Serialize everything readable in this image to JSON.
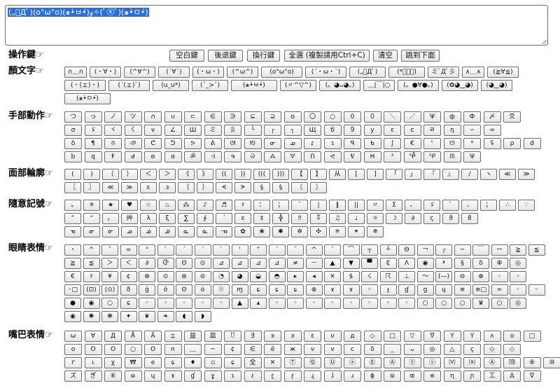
{
  "editor": {
    "text": "(„ﾟДﾟ)(o°ω°o)(๑•̀ㅂ•́)و✧(ﾟ㉨ﾟ)(๑•̀ㅁ•́)"
  },
  "sections": {
    "operations": "操作鍵☞",
    "faces": "顏文字☞",
    "hands": "手部動作☞",
    "outline": "面部輪廓☞",
    "misc": "隨意記號☞",
    "eyes": "眼睛表情☞",
    "mouth": "嘴巴表情☞"
  },
  "controls": [
    "空白鍵",
    "後退鍵",
    "換行鍵",
    "全選 (複製請用Ctrl+C)",
    "清空",
    "跳到下面"
  ],
  "faces": [
    "∩＿∩",
    "(・∀・)",
    "(^∀^)",
    "(´∀`)",
    "(・ω・)",
    "(^ω^)",
    "(o°ω°o)",
    "(´・ω・`)",
    "(„ﾟДﾟ)",
    "(*ﾟーﾟ)",
    "ミﾟДﾟ彡",
    "∧＿∧",
    "(≧∀≦)",
    "(・(ェ)・)",
    "(´(ェ)`)",
    "(u_u*)",
    "(´_>`)",
    "(๑•̀ㅂ•́)",
    "(〃^▽^)",
    "(。◕ᴗ◕。)",
    "＿|￣|○",
    "(。●∀●。)",
    "(✿◕‿◕)",
    "(◕‿◕)",
    "(๑•̀ㅁ•́)"
  ],
  "hands": {
    "row1": [
      "つ",
      "っ",
      "ノ",
      "ツ",
      "∩",
      "∪",
      "⊂",
      "∈",
      "∋",
      "⊆",
      "⊇",
      "ｏ",
      "〇",
      "○",
      "0",
      "０",
      "＼",
      "／",
      "Ψ",
      "ф",
      "Ф",
      "〆",
      "爻"
    ],
    "row2": [
      "σ",
      "ゞ",
      "ヾ",
      "ㄑ",
      "ν",
      "∠",
      "Ш",
      "ミ",
      "彡",
      "└",
      "┌",
      "┐",
      "Щ",
      "б",
      "９",
      "ｙ",
      "ε",
      "ｃ",
      "ㄹ",
      "η",
      "∽",
      "∞"
    ],
    "row3": [
      "δ",
      "¶",
      "ঙ",
      "ঞ",
      "ᕦ",
      "ᕤ",
      "ᕗ",
      "ᕕ",
      "ᘛ",
      "ᘚ",
      "ᓂ",
      "ᓄ",
      "ɾ",
      "ɿ",
      "ᑫ",
      "ᑲ",
      "∫",
      "€",
      "ᵗ",
      "ᘎ",
      "ᓑ",
      "ʢ",
      "ρ",
      "d"
    ],
    "row4": [
      "b",
      "q",
      "Ꞙ",
      "ᑯ",
      "ʚ",
      "ɞ",
      "ॐ",
      "ଏ",
      "ຈ",
      "ᘐ",
      "ᗋ",
      "ᗊ",
      "ᑎ",
      "ᕙ",
      "ᕓ",
      "ᕼ",
      "ᕽ",
      "ᕾ",
      "ᕿ",
      "ᙏ",
      "Ψ"
    ]
  },
  "outline": {
    "row1": [
      "(",
      ")",
      "（",
      "）",
      "＜",
      "＞",
      "《",
      "》",
      "((",
      "))",
      "(((",
      ")))",
      "【",
      "】",
      "从",
      "[",
      "]",
      "「",
      "」",
      "『",
      "』",
      "/",
      "ヽ",
      "≪",
      "≫"
    ],
    "row2": [
      "〖",
      "〗",
      "≪",
      "≫",
      "ɛ",
      "з",
      "〔",
      "〕",
      "ᗕ",
      "ᗒ",
      "§",
      "§",
      "〘",
      "〙"
    ]
  },
  "misc": {
    "row1": [
      "｡",
      "＊",
      "★",
      "♥",
      "☆",
      "♨",
      "⁂",
      "♪",
      "♬",
      "♯",
      "：",
      "；",
      "¨",
      "|",
      "‖",
      "||",
      "〃",
      "Σ",
      "、",
      "ゞ",
      "ﾟ",
      "．",
      "；",
      "∴",
      "∵"
    ],
    "row2": [
      "”",
      "“",
      "〟",
      "艸",
      "λ",
      "ξ",
      "∑",
      "∮",
      "´",
      "ɛ",
      "‡",
      "╬",
      "‼",
      "⁑",
      "♫",
      "♩",
      "☼",
      "☽",
      "∂",
      "ς",
      "ϑ",
      "ϐ"
    ],
    "row3": [
      "ᓀ",
      "ᓂ",
      "ᓃ",
      "ᓄ",
      "ᓅ",
      "ᓆ",
      "ᓇ",
      "ᓈ",
      "ᓉ",
      "✿",
      "❀",
      "✱",
      "✲",
      "✣",
      "✳",
      "✴",
      "✵"
    ]
  },
  "eyes": {
    "row1": [
      "・",
      "^",
      "ˇ",
      "=",
      "°",
      "ˋ",
      "ˊ",
      "ˊ",
      "ˋ",
      "'",
      "”",
      "´",
      "˜",
      "^",
      "ˉ",
      "⌒",
      "┬",
      "┴",
      "Θ",
      "￢",
      "┌",
      "─",
      "￣",
      "ー",
      "≧",
      "≦"
    ],
    "row2": [
      "≧",
      "≦",
      "＞",
      "＜",
      "∂",
      "Ⴇ",
      "ʘ",
      "⊙",
      "⊿",
      "⊿",
      "⊿",
      "⊿",
      "≠",
      "－",
      "▲",
      "▼",
      "▀",
      "₵",
      "Λ",
      "◉",
      "ᵜ",
      "§",
      "δ",
      "Φ",
      "◎"
    ],
    "row3": [
      "€",
      "♯",
      "¥",
      "¢",
      "⊕",
      "⊙",
      "⊛",
      "⊝",
      "◔",
      "◕",
      "◒",
      "◓",
      "▸",
      "◂",
      "✕",
      "$",
      "☇",
      "☈",
      "⊥",
      "～",
      "(—)",
      "⊖",
      "⊕",
      "◦",
      "◦"
    ],
    "row4": [
      "◦□",
      "(⊡)",
      "(⊙)",
      "ð",
      "ğ",
      "ō",
      "ʘ",
      "ȯ",
      "☉",
      "ɱ",
      "ɕ",
      "ɕ",
      "ɕ",
      "⊗",
      "ɤ",
      "ɤ",
      "◦",
      "ɟ",
      "ɠ",
      "ɡ",
      "ɥ",
      "≡",
      "≡□",
      "≈",
      "◦",
      "◦"
    ],
    "row5": [
      "●",
      "◉",
      "○",
      "ɕ",
      "◦",
      "◦",
      "◦",
      "◦",
      "◦",
      "▲",
      "▴",
      "◦",
      "◦",
      "◦",
      "◦",
      "◦",
      "◦",
      "◦",
      "◦",
      "○",
      "○",
      "○",
      "♛",
      "○",
      "◎"
    ],
    "row6": [
      "◉",
      "✺",
      "❋",
      "✦",
      "❦",
      "❧",
      "◖",
      "◗"
    ]
  },
  "mouth": {
    "row1": [
      "ω",
      "∀",
      "Д",
      "Å",
      "Ä",
      "ェ",
      "益",
      "皿",
      "ꇴ",
      "Ǝ",
      "϶",
      "э",
      "ε",
      "υ",
      "д",
      "◇",
      "□",
      "▽",
      "∇",
      "Y",
      "Y",
      "ʌ",
      "ο",
      "□"
    ],
    "row2": [
      "ο",
      "O",
      "O",
      "○",
      "O",
      "n",
      "＿",
      "─",
      "¢",
      "∈",
      "ë",
      "ж",
      "ν",
      "v",
      "c",
      "δ",
      "_",
      "ᴗ",
      "◎",
      "△",
      "ç",
      "◇",
      "◇"
    ],
    "row3": [
      "ґ",
      "ι",
      "χ",
      "₩",
      "e",
      "ɕ",
      "♦",
      "▫",
      "ɕ",
      "全",
      "✕",
      "Ⓣ",
      "Ⓠ",
      "Ⓤ",
      "ⓧ",
      "Ⓔ",
      "Ⓐ",
      "ⓨ",
      "ⓥ",
      "⒱",
      "⒳",
      "Ⓐ",
      "⒆",
      "⑧",
      "⑩"
    ],
    "row4": [
      "ズ",
      "ぎ",
      "⑥",
      "ɷ",
      "ɥ",
      "ɤ",
      "ɠ",
      "ɣ",
      "ɿ",
      "ɾ",
      "ɽ",
      "ɼ",
      "ɻ",
      "ɺ",
      "ɹ",
      "ɸ",
      "ɷ",
      "ɶ",
      "ɵ",
      "ɳ",
      "ɲ",
      "工",
      "ᐃ",
      "ᐁ"
    ]
  }
}
